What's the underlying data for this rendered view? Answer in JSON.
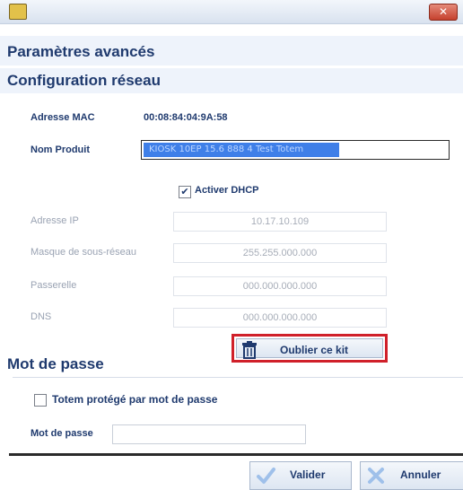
{
  "window": {
    "close_glyph": "✕"
  },
  "header": {
    "title": "Paramètres avancés"
  },
  "network": {
    "section_title": "Configuration réseau",
    "mac_label": "Adresse MAC",
    "mac_value": "00:08:84:04:9A:58",
    "product_label": "Nom Produit",
    "product_value": "KIOSK 10EP 15.6 888 4 Test Totem",
    "dhcp_label": "Activer DHCP",
    "dhcp_checked": true,
    "ip_label": "Adresse IP",
    "ip_value": "10.17.10.109",
    "mask_label": "Masque de sous-réseau",
    "mask_value": "255.255.000.000",
    "gateway_label": "Passerelle",
    "gateway_value": "000.000.000.000",
    "dns_label": "DNS",
    "dns_value": "000.000.000.000",
    "forget_button": "Oublier ce kit"
  },
  "password": {
    "section_title": "Mot de passe",
    "protect_label": "Totem protégé par mot de passe",
    "protect_checked": false,
    "password_label": "Mot de passe",
    "password_value": ""
  },
  "footer": {
    "validate_label": "Valider",
    "cancel_label": "Annuler"
  },
  "colors": {
    "accent": "#1f3a6e",
    "highlight_border": "#d0202a",
    "selection": "#3f7fe8"
  },
  "icons": {
    "app": "app-icon",
    "close": "close-icon",
    "check": "checkmark-icon",
    "trash": "trash-icon",
    "validate": "check-icon",
    "cancel": "x-icon"
  }
}
